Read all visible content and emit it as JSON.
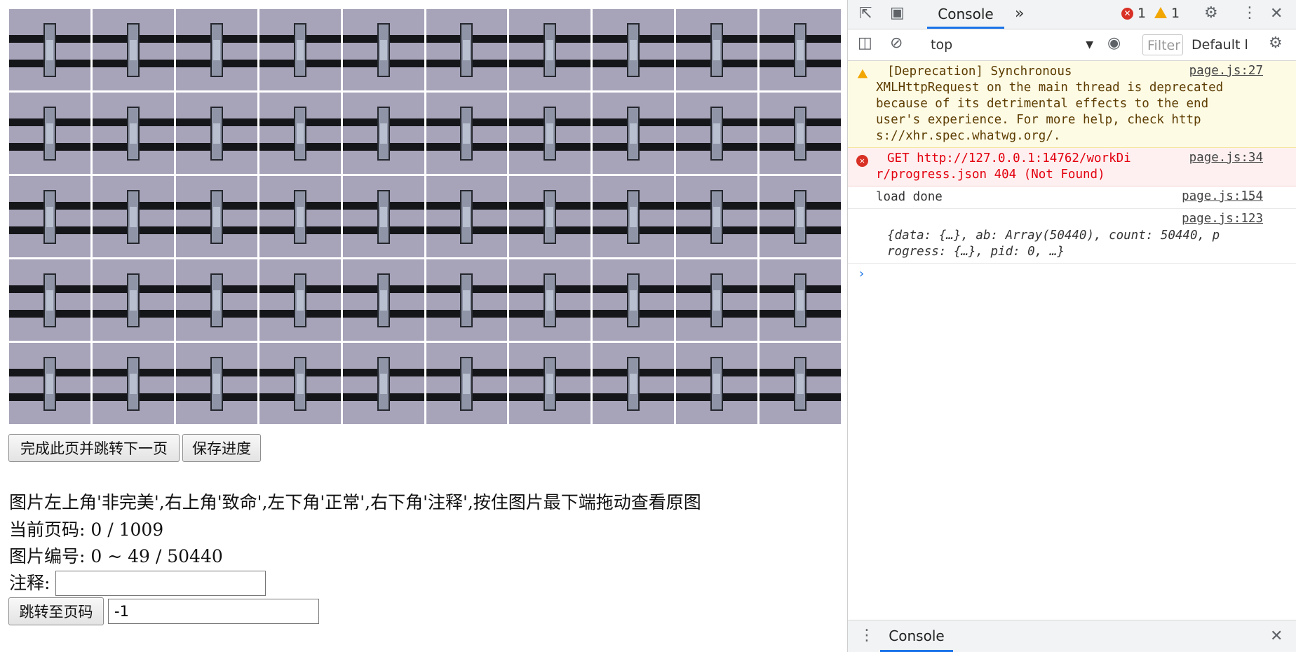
{
  "page": {
    "buttons": {
      "finish_label": "完成此页并跳转下一页",
      "save_label": "保存进度",
      "jump_label": "跳转至页码"
    },
    "instructions": "图片左上角'非完美',右上角'致命',左下角'正常',右下角'注释',按住图片最下端拖动查看原图",
    "current_page_label": "当前页码: 0 / 1009",
    "image_ids_label": "图片编号: 0 ~ 49 / 50440",
    "note_label": "注释:",
    "note_value": "",
    "jump_value": "-1",
    "grid": {
      "rows": 5,
      "cols": 10
    }
  },
  "devtools": {
    "active_tab": "Console",
    "more_tabs_icon": "chevron-double-right-icon",
    "error_count": "1",
    "warning_count": "1",
    "context": "top",
    "filter_placeholder": "Filter",
    "levels": "Default l",
    "messages": [
      {
        "type": "warning",
        "lines": [
          "[Deprecation] Synchronous",
          "XMLHttpRequest on the main thread is deprecated",
          "because of its detrimental effects to the end",
          "user's experience. For more help, check http",
          "s://xhr.spec.whatwg.org/."
        ],
        "source": "page.js:27"
      },
      {
        "type": "error",
        "lines": [
          "GET http://127.0.0.1:14762/workDi",
          "r/progress.json 404 (Not Found)"
        ],
        "source": "page.js:34"
      },
      {
        "type": "log",
        "lines": [
          "load done"
        ],
        "source": "page.js:154"
      },
      {
        "type": "log",
        "lines": [
          "{data: {…}, ab: Array(50440), count: 50440, p",
          "rogress: {…}, pid: 0, …}"
        ],
        "source": "page.js:123"
      }
    ],
    "drawer_tab": "Console",
    "colors": {
      "accent": "#1a73e8",
      "error": "#d93025",
      "warning": "#f2a600"
    }
  }
}
